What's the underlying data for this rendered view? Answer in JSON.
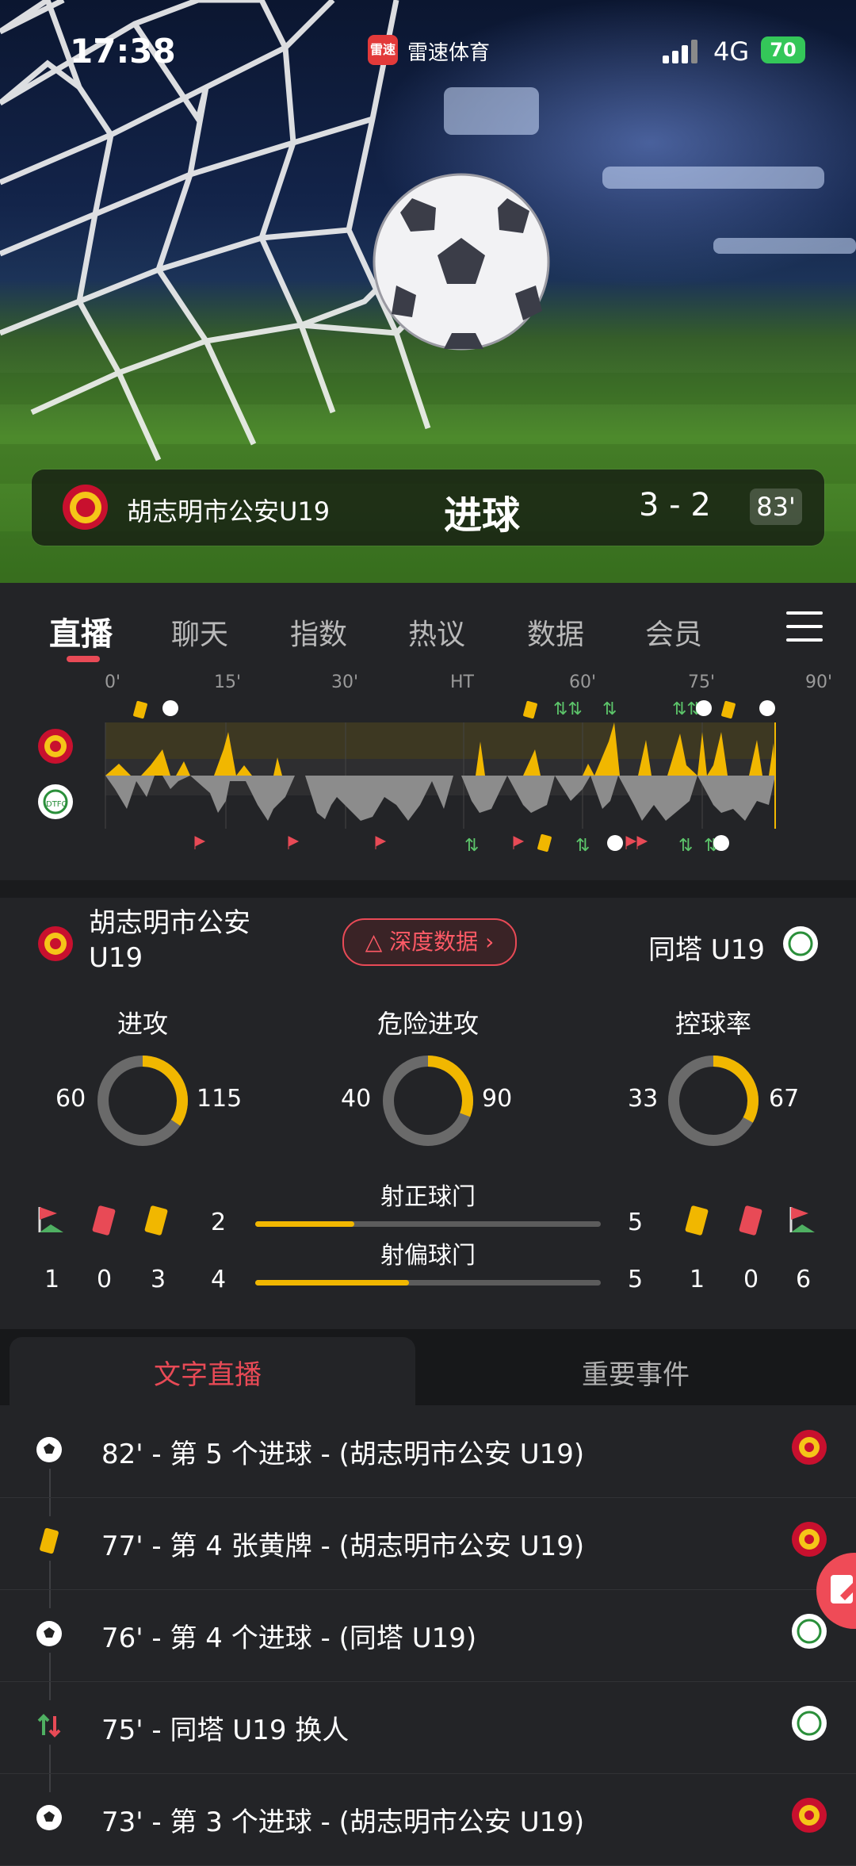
{
  "status_bar": {
    "time": "17:38",
    "app_badge": "雷速",
    "app_name": "雷速体育",
    "network": "4G",
    "battery": "70"
  },
  "score_bar": {
    "team": "胡志明市公安U19",
    "event": "进球",
    "score": "3 - 2",
    "minute": "83'"
  },
  "tabs": [
    {
      "label": "直播",
      "active": true
    },
    {
      "label": "聊天",
      "active": false
    },
    {
      "label": "指数",
      "active": false
    },
    {
      "label": "热议",
      "active": false
    },
    {
      "label": "数据",
      "active": false
    },
    {
      "label": "会员",
      "active": false
    }
  ],
  "timeline": {
    "ticks": [
      "0'",
      "15'",
      "30'",
      "HT",
      "60'",
      "75'",
      "90'"
    ],
    "current_minute": 83
  },
  "stats": {
    "home_name": "胡志明市公安U19",
    "away_name": "同塔 U19",
    "deep_data_label": "深度数据",
    "metrics": [
      {
        "title": "进攻",
        "home": "60",
        "away": "115",
        "home_value": 60,
        "away_value": 115
      },
      {
        "title": "危险进攻",
        "home": "40",
        "away": "90",
        "home_value": 40,
        "away_value": 90
      },
      {
        "title": "控球率",
        "home": "33",
        "away": "67",
        "home_value": 33,
        "away_value": 67
      }
    ],
    "bars": [
      {
        "label": "射正球门",
        "home": "2",
        "away": "5",
        "home_value": 2,
        "away_value": 5
      },
      {
        "label": "射偏球门",
        "home": "4",
        "away": "5",
        "home_value": 4,
        "away_value": 5
      }
    ],
    "home_cards": {
      "corners": "1",
      "red": "0",
      "yellow": "3"
    },
    "away_cards": {
      "yellow": "1",
      "red": "0",
      "corners": "6"
    },
    "colors": {
      "accent": "#f1b700",
      "track": "#6a6a6a",
      "red": "#e84a56"
    }
  },
  "feed": {
    "tab_live": "文字直播",
    "tab_events": "重要事件",
    "items": [
      {
        "icon": "ball-icon",
        "text": "82' - 第 5 个进球 - (胡志明市公安 U19)",
        "team": "home"
      },
      {
        "icon": "yellow-card-icon",
        "text": "77' - 第 4 张黄牌 - (胡志明市公安 U19)",
        "team": "home"
      },
      {
        "icon": "ball-icon",
        "text": "76' - 第 4 个进球 - (同塔 U19)",
        "team": "away"
      },
      {
        "icon": "substitution-icon",
        "text": "75' - 同塔 U19 换人",
        "team": "away"
      },
      {
        "icon": "ball-icon",
        "text": "73' - 第 3 个进球 - (胡志明市公安 U19)",
        "team": "home"
      }
    ]
  }
}
